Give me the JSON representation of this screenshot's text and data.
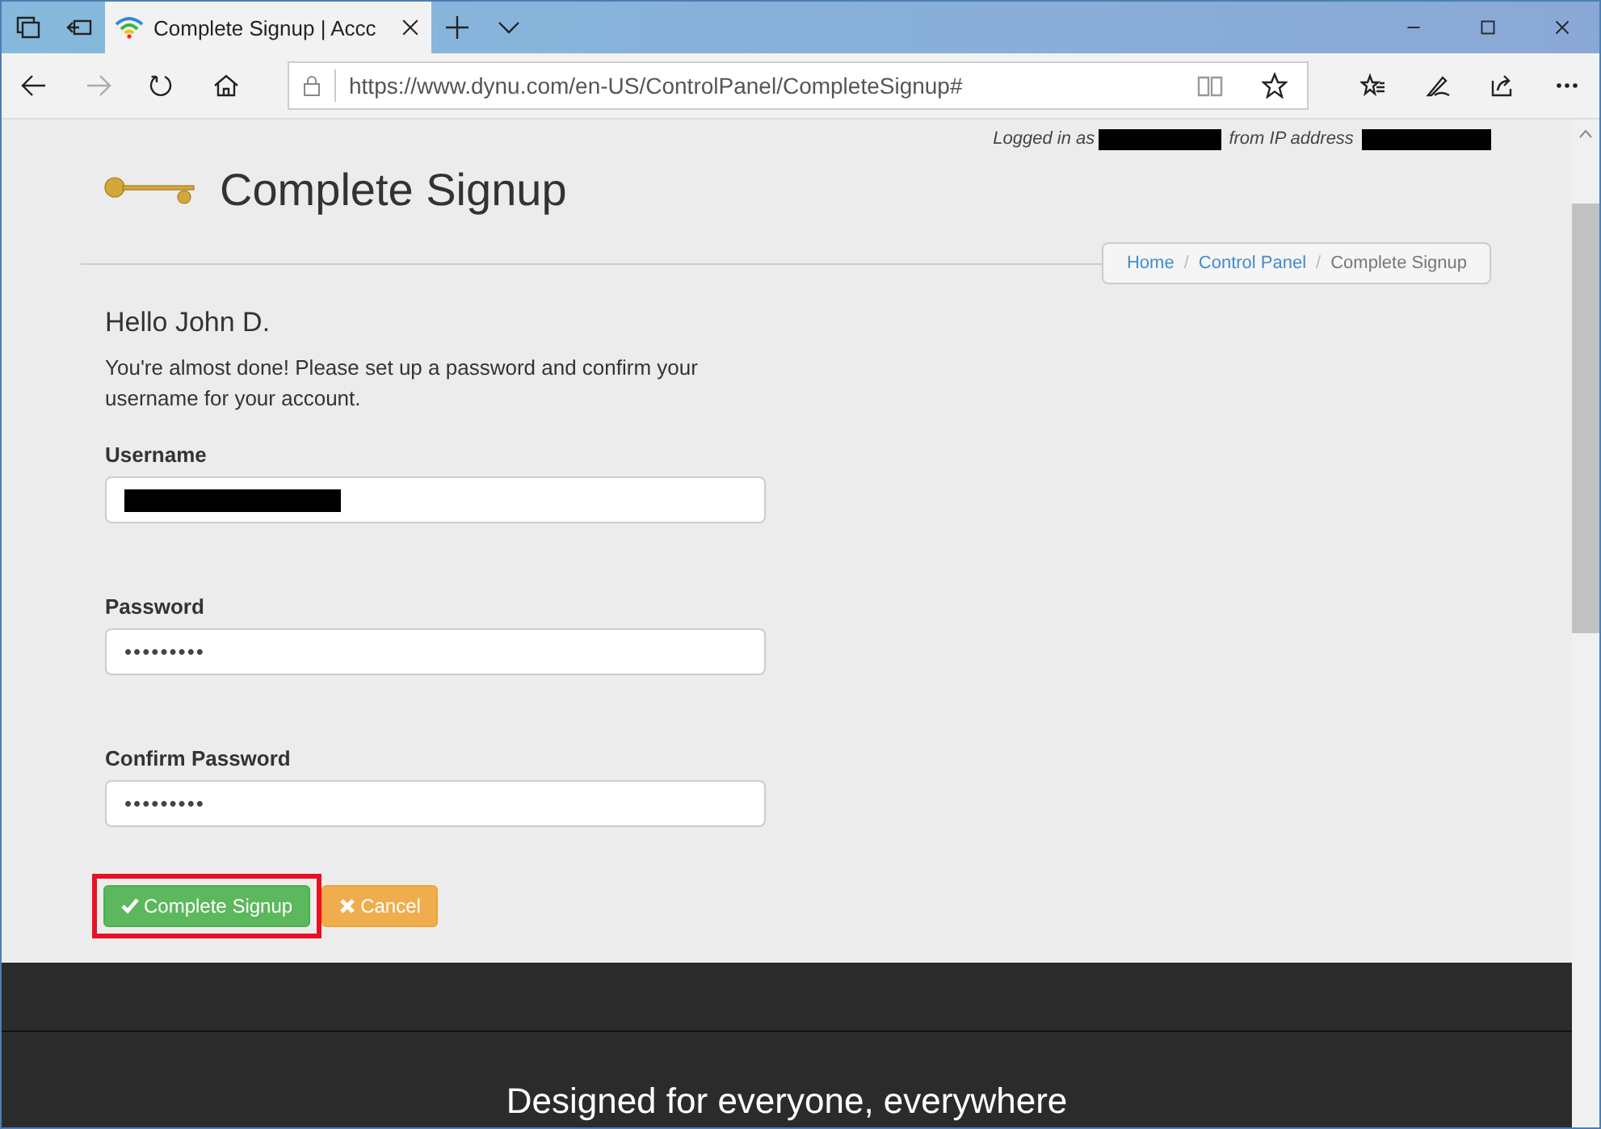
{
  "browser": {
    "tab_title": "Complete Signup | Accc",
    "address": "https://www.dynu.com/en-US/ControlPanel/CompleteSignup#"
  },
  "page": {
    "login_notice": {
      "prefix": "Logged in as",
      "middle": "from IP address"
    },
    "title": "Complete Signup",
    "breadcrumb_separator": "/",
    "breadcrumb": [
      {
        "label": "Home",
        "kind": "link"
      },
      {
        "label": "Control Panel",
        "kind": "link"
      },
      {
        "label": "Complete Signup",
        "kind": "current"
      }
    ],
    "greeting": "Hello John D.",
    "intro": "You're almost done! Please set up a password and confirm your username for your account.",
    "fields": [
      {
        "label": "Username",
        "kind": "redacted"
      },
      {
        "label": "Password",
        "kind": "masked",
        "value": "•••••••••"
      },
      {
        "label": "Confirm Password",
        "kind": "masked",
        "value": "•••••••••"
      }
    ],
    "buttons": [
      {
        "label": "Complete Signup",
        "kind": "success",
        "highlighted": true
      },
      {
        "label": "Cancel",
        "kind": "warning",
        "highlighted": false
      }
    ]
  },
  "footer": {
    "tagline": "Designed for everyone, everywhere"
  }
}
